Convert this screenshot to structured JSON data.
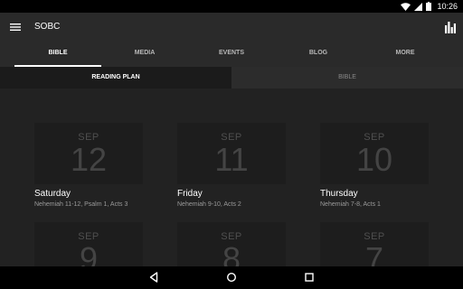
{
  "status_bar": {
    "time": "10:26"
  },
  "app_bar": {
    "title": "SOBC"
  },
  "tabs": [
    {
      "label": "BIBLE",
      "active": true
    },
    {
      "label": "MEDIA",
      "active": false
    },
    {
      "label": "EVENTS",
      "active": false
    },
    {
      "label": "BLOG",
      "active": false
    },
    {
      "label": "MORE",
      "active": false
    }
  ],
  "subtabs": [
    {
      "label": "READING PLAN",
      "active": true
    },
    {
      "label": "BIBLE",
      "active": false
    }
  ],
  "cards": [
    {
      "month": "SEP",
      "day": "12",
      "weekday": "Saturday",
      "readings": "Nehemiah 11-12, Psalm 1, Acts 3"
    },
    {
      "month": "SEP",
      "day": "11",
      "weekday": "Friday",
      "readings": "Nehemiah 9-10, Acts 2"
    },
    {
      "month": "SEP",
      "day": "10",
      "weekday": "Thursday",
      "readings": "Nehemiah 7-8, Acts 1"
    },
    {
      "month": "SEP",
      "day": "9"
    },
    {
      "month": "SEP",
      "day": "8"
    },
    {
      "month": "SEP",
      "day": "7"
    }
  ],
  "colors": {
    "app_bar": "#2a2a2a",
    "background": "#222222",
    "tile": "#1d1d1d",
    "status_bar": "#000000"
  },
  "icons": {
    "menu": "menu-icon",
    "chart": "chart-icon",
    "wifi": "wifi-icon",
    "signal": "signal-icon",
    "battery": "battery-icon",
    "back": "back-icon",
    "home": "home-icon",
    "recents": "recents-icon"
  }
}
